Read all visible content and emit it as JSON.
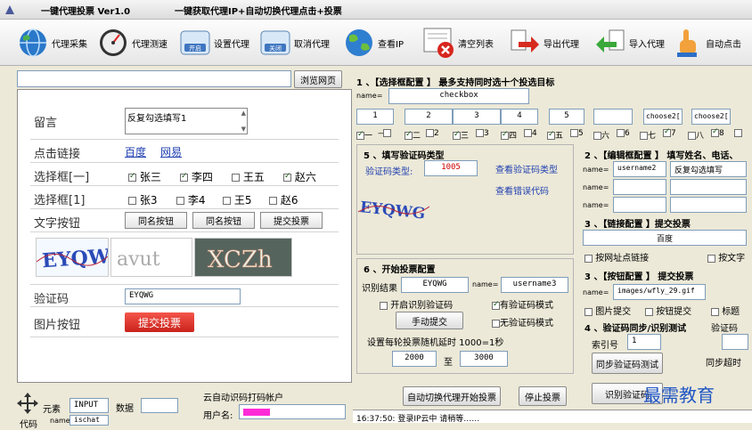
{
  "title": {
    "app": "一键代理投票 Ver1.0",
    "subtitle": "一键获取代理IP+自动切换代理点击+投票"
  },
  "toolbar": [
    {
      "label": "代理采集",
      "icon": "globe-icon"
    },
    {
      "label": "代理测速",
      "icon": "speedometer-icon"
    },
    {
      "label": "设置代理",
      "icon": "open-box-icon",
      "badge": "开启"
    },
    {
      "label": "取消代理",
      "icon": "close-box-icon",
      "badge": "关闭"
    },
    {
      "label": "查看IP",
      "icon": "globe-search-icon"
    },
    {
      "label": "清空列表",
      "icon": "clear-list-icon"
    },
    {
      "label": "导出代理",
      "icon": "export-arrow-icon"
    },
    {
      "label": "导入代理",
      "icon": "import-arrow-icon"
    },
    {
      "label": "自动点击",
      "icon": "hand-pointer-icon"
    }
  ],
  "browse": {
    "button": "浏览网页"
  },
  "webpage": {
    "rows": {
      "comment": "留言",
      "comment_value": "反复勾选填写1",
      "link": "点击链接",
      "link1": "百度",
      "link2": "网易",
      "check0": "选择框[一]",
      "check0_items": [
        "张三",
        "李四",
        "王五",
        "赵六"
      ],
      "check1": "选择框[1]",
      "check1_items": [
        "张3",
        "李4",
        "王5",
        "赵6"
      ],
      "textbtn": "文字按钮",
      "textbtn_items": [
        "同名按钮",
        "同名按钮",
        "提交投票"
      ],
      "vcode": "验证码",
      "vcode_value": "EYQWG",
      "imgbtn": "图片按钮",
      "imgbtn_label": "提交投票"
    },
    "captchas": [
      "EYQWG",
      "avut",
      "XCZh"
    ]
  },
  "bottom_left": {
    "element_label": "元素",
    "element_value": "INPUT",
    "data_label": "数据",
    "attr_label": "代码",
    "attr_name": "name",
    "attr_value": "ischat",
    "cloud_title": "云自动识码打码帐户",
    "user_label": "用户名:"
  },
  "sec1": {
    "title": "1 、【选择框配置 】 最多支持同时选十个投选目标",
    "name_label": "name=",
    "name_value": "checkbox",
    "values": [
      "1",
      "2",
      "3",
      "4",
      "5",
      "",
      "choose2[",
      "choose2["
    ],
    "checks": [
      {
        "label": "一",
        "on": true
      },
      {
        "label": "二",
        "on": true
      },
      {
        "label": "三",
        "on": true
      },
      {
        "label": "四",
        "on": true
      },
      {
        "label": "五",
        "on": true
      },
      {
        "label": "六",
        "on": false
      },
      {
        "label": "七",
        "on": false
      },
      {
        "label": "八",
        "on": true
      },
      {
        "label": "九",
        "on": true
      }
    ]
  },
  "sec5": {
    "title": "5 、填写验证码类型",
    "type_label": "验证码类型:",
    "type_value": "1005",
    "link1": "查看验证码类型",
    "link2": "查看错误代码",
    "captcha": "EYQWG"
  },
  "sec6": {
    "title": "6 、开始投票配置",
    "result_label": "识别结果",
    "result_value": "EYQWG",
    "name_label": "name=",
    "name_value": "username3",
    "opt1": "开启识别验证码",
    "opt2": "有验证码模式",
    "opt3": "无验证码模式",
    "manual_button": "手动提交",
    "delay_text": "设置每轮投票随机延时  1000=1秒",
    "delay_from": "2000",
    "to_label": "至",
    "delay_to": "3000",
    "start_button": "自动切换代理开始投票",
    "stop_button": "停止投票"
  },
  "sec2": {
    "title": "2 、【编辑框配置 】 填写姓名、电话、",
    "name_label": "name=",
    "name1": "username2",
    "value1": "反复勾选填写"
  },
  "sec3a": {
    "title": "3 、【链接配置 】提交投票",
    "link_value": "百度",
    "opt1": "按网址点链接",
    "opt2": "按文字"
  },
  "sec3b": {
    "title": "3 、【按钮配置 】 提交投票",
    "name_label": "name=",
    "name_value": "images/wfly_29.gif",
    "opt1": "图片提交",
    "opt2": "按钮提交",
    "opt3": "标题"
  },
  "sec4": {
    "title": "4 、验证码同步/识别测试",
    "extra": "验证码",
    "index_label": "索引号",
    "index_value": "1",
    "sync_button": "同步验证码测试",
    "timeout_label": "同步超时",
    "recog_button": "识别验证码"
  },
  "status": {
    "log": "16:37:50: 登录IP云中 请稍等……"
  },
  "watermark": "最需教育"
}
